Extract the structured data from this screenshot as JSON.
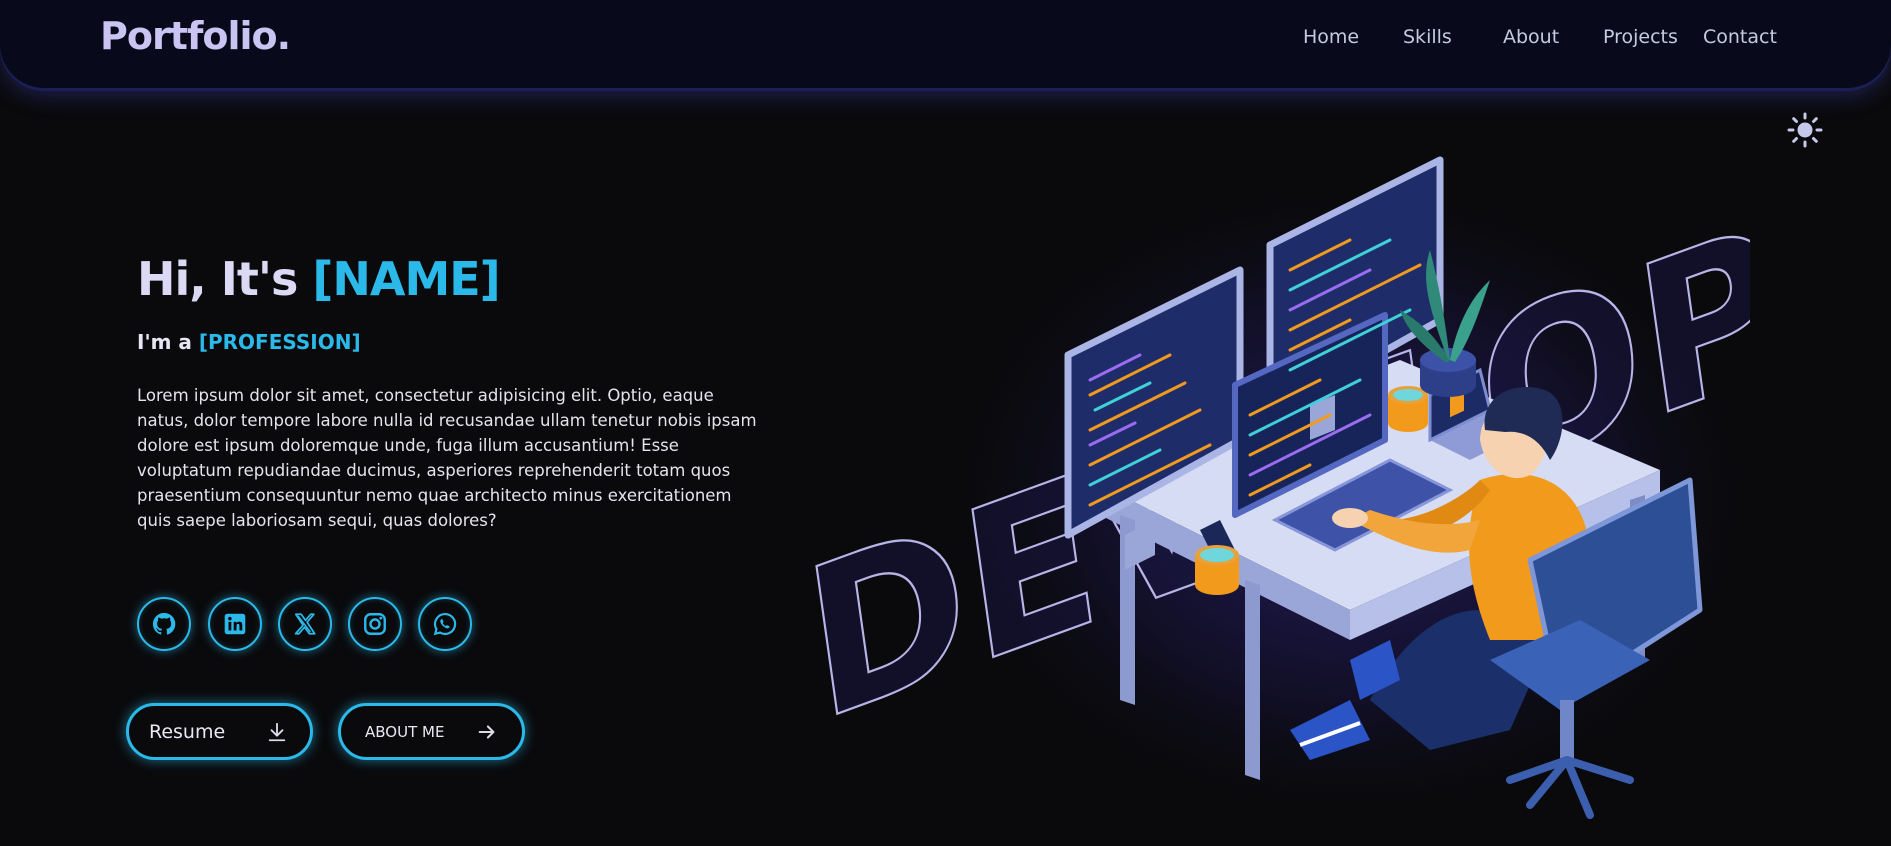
{
  "nav": {
    "logo": "Portfolio.",
    "links": [
      "Home",
      "Skills",
      "About",
      "Projects",
      "Contact"
    ],
    "theme_icon": "sun-icon"
  },
  "hero": {
    "greeting_prefix": "Hi, It's ",
    "name": "[NAME]",
    "profession_prefix": "I'm a ",
    "profession": "[PROFESSION]",
    "bio": "Lorem ipsum dolor sit amet, consectetur adipisicing elit. Optio, eaque natus, dolor tempore labore nulla id recusandae ullam tenetur nobis ipsam dolore est ipsum doloremque unde, fuga illum accusantium! Esse voluptatum repudiandae ducimus, asperiores reprehenderit totam quos praesentium consequuntur nemo quae architecto minus exercitationem quis saepe laboriosam sequi, quas dolores?"
  },
  "socials": [
    {
      "icon": "github-icon"
    },
    {
      "icon": "linkedin-icon"
    },
    {
      "icon": "x-icon"
    },
    {
      "icon": "instagram-icon"
    },
    {
      "icon": "whatsapp-icon"
    }
  ],
  "buttons": {
    "resume_label": "Resume",
    "resume_icon": "download-icon",
    "about_label": "ABOUT ME",
    "about_icon": "arrow-right-icon"
  },
  "illustration": {
    "outline_text": "DEVELOP",
    "subject": "developer-at-desk-illustration"
  },
  "colors": {
    "accent": "#2bb9ea",
    "logo": "#c9c4f2",
    "navbar_bg": "#080a1c",
    "page_bg": "#0a0a0c",
    "shirt": "#f29a1c",
    "chair": "#2c4f96"
  }
}
